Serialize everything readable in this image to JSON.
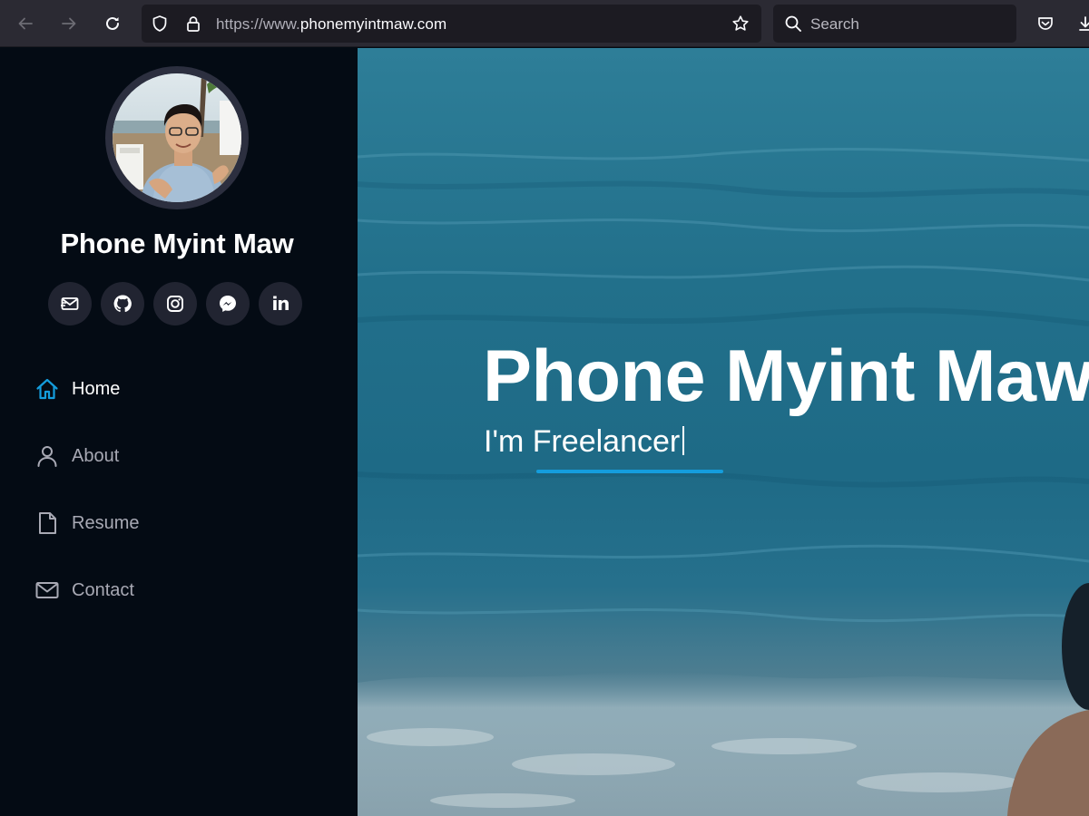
{
  "browser": {
    "url_protocol": "https://www.",
    "url_domain": "phonemyintmaw.com",
    "search_placeholder": "Search",
    "icons": [
      "back-arrow-icon",
      "forward-arrow-icon",
      "reload-icon",
      "shield-icon",
      "lock-icon",
      "star-icon",
      "search-icon",
      "pocket-icon",
      "download-icon"
    ]
  },
  "sidebar": {
    "name": "Phone Myint Maw",
    "socials": [
      {
        "name": "email",
        "icon": "mail-icon"
      },
      {
        "name": "github",
        "icon": "github-icon"
      },
      {
        "name": "instagram",
        "icon": "instagram-icon"
      },
      {
        "name": "messenger",
        "icon": "messenger-icon"
      },
      {
        "name": "linkedin",
        "icon": "linkedin-icon",
        "text": "in"
      }
    ],
    "nav": [
      {
        "label": "Home",
        "icon": "home-icon",
        "active": true
      },
      {
        "label": "About",
        "icon": "person-icon",
        "active": false
      },
      {
        "label": "Resume",
        "icon": "file-icon",
        "active": false
      },
      {
        "label": "Contact",
        "icon": "envelope-icon",
        "active": false
      }
    ]
  },
  "hero": {
    "title": "Phone Myint Maw",
    "subtitle_prefix": "I'm ",
    "typed_word": "Freelancer"
  },
  "colors": {
    "accent": "#149ddd",
    "sidebar_bg": "#040b14",
    "social_bg": "#212431",
    "nav_text": "#a8a9b4"
  }
}
